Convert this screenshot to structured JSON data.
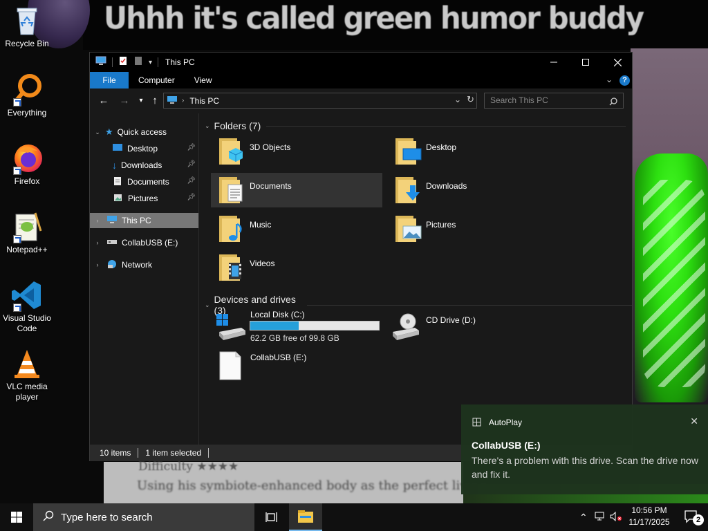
{
  "wallpaper": {
    "caption": "Uhhh it's called green humor buddy",
    "paper_line1": "Difficulty ★★★★",
    "paper_line2": "Using his symbiote-enhanced body as the perfect living"
  },
  "desktop_icons": [
    {
      "label": "Recycle Bin"
    },
    {
      "label": "Everything"
    },
    {
      "label": "Firefox"
    },
    {
      "label": "Notepad++"
    },
    {
      "label": "Visual Studio Code"
    },
    {
      "label": "VLC media player"
    }
  ],
  "explorer": {
    "title": "This PC",
    "tabs": [
      "File",
      "Computer",
      "View"
    ],
    "address": "This PC",
    "search_placeholder": "Search This PC",
    "nav": {
      "quick_access": "Quick access",
      "items": [
        "Desktop",
        "Downloads",
        "Documents",
        "Pictures"
      ],
      "this_pc": "This PC",
      "usb": "CollabUSB (E:)",
      "network": "Network"
    },
    "folders_header": "Folders (7)",
    "folders": [
      "3D Objects",
      "Desktop",
      "Documents",
      "Downloads",
      "Music",
      "Pictures",
      "Videos"
    ],
    "drives_header": "Devices and drives (3)",
    "drives": {
      "c_label": "Local Disk (C:)",
      "c_free": "62.2 GB free of 99.8 GB",
      "c_used_fraction": 0.377,
      "d_label": "CD Drive (D:)",
      "e_label": "CollabUSB (E:)"
    },
    "status": {
      "items": "10 items",
      "selected": "1 item selected"
    }
  },
  "toast": {
    "app": "AutoPlay",
    "title": "CollabUSB (E:)",
    "body": "There's a problem with this drive.  Scan the drive now and fix it."
  },
  "taskbar": {
    "search_placeholder": "Type here to search",
    "time": "10:56 PM",
    "date": "11/17/2025",
    "notification_count": "2"
  },
  "colors": {
    "accent": "#1979ca",
    "drive_bar": "#26a0da",
    "toast_bg": "#1e341e"
  }
}
